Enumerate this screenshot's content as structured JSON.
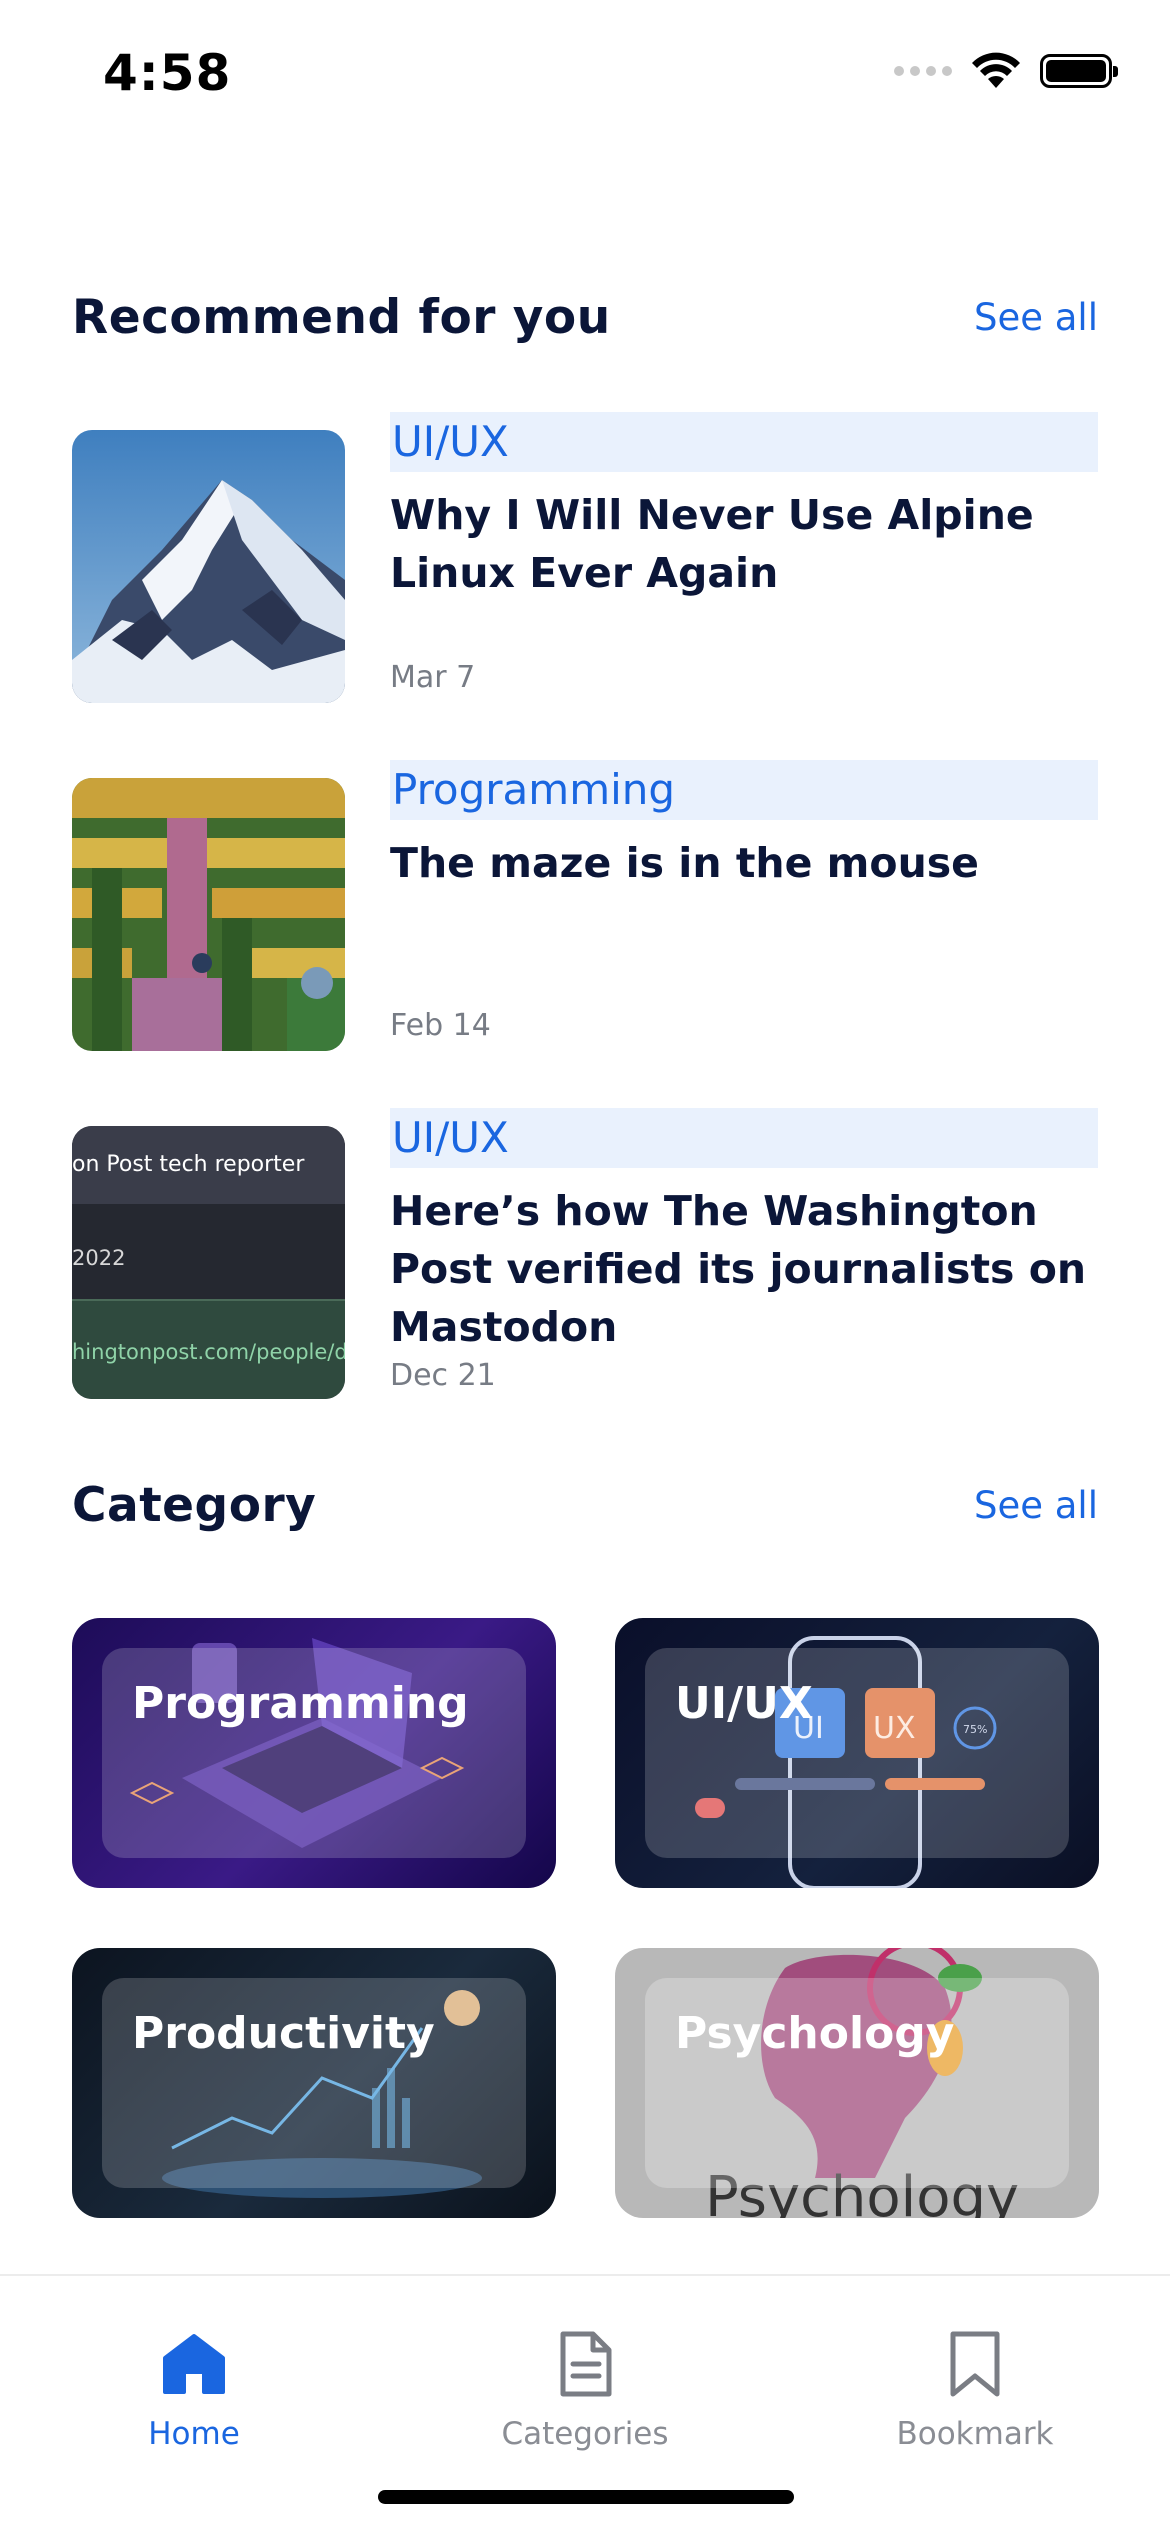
{
  "status_bar": {
    "time": "4:58"
  },
  "recommend": {
    "title": "Recommend for you",
    "see_all": "See all",
    "articles": [
      {
        "tag": "UI/UX",
        "title": "Why I Will Never Use Alpine Linux Ever Again",
        "date": "Mar 7",
        "thumb": "mountain-photo"
      },
      {
        "tag": "Programming",
        "title": "The maze is in the mouse",
        "date": "Feb 14",
        "thumb": "maze-painting"
      },
      {
        "tag": "UI/UX",
        "title": "Here’s how The Washington Post verified its journalists on Mastodon",
        "date": "Dec 21",
        "thumb": "profile-screenshot",
        "thumb_text": [
          "on Post tech reporter",
          "2022",
          "hingtonpost.com/people/dre"
        ]
      }
    ]
  },
  "category": {
    "title": "Category",
    "see_all": "See all",
    "items": [
      {
        "label": "Programming"
      },
      {
        "label": "UI/UX",
        "image_text": [
          "UI",
          "UX",
          "75%"
        ]
      },
      {
        "label": "Productivity"
      },
      {
        "label": "Psychology",
        "image_text": [
          "Psychology"
        ]
      }
    ]
  },
  "bottom_nav": {
    "items": [
      {
        "label": "Home",
        "icon": "home-icon",
        "active": true
      },
      {
        "label": "Categories",
        "icon": "document-icon",
        "active": false
      },
      {
        "label": "Bookmark",
        "icon": "bookmark-icon",
        "active": false
      }
    ]
  },
  "colors": {
    "accent": "#1a66e0",
    "tag_bg": "#e9f1fd",
    "heading": "#0b1638",
    "muted": "#8a8d94"
  }
}
